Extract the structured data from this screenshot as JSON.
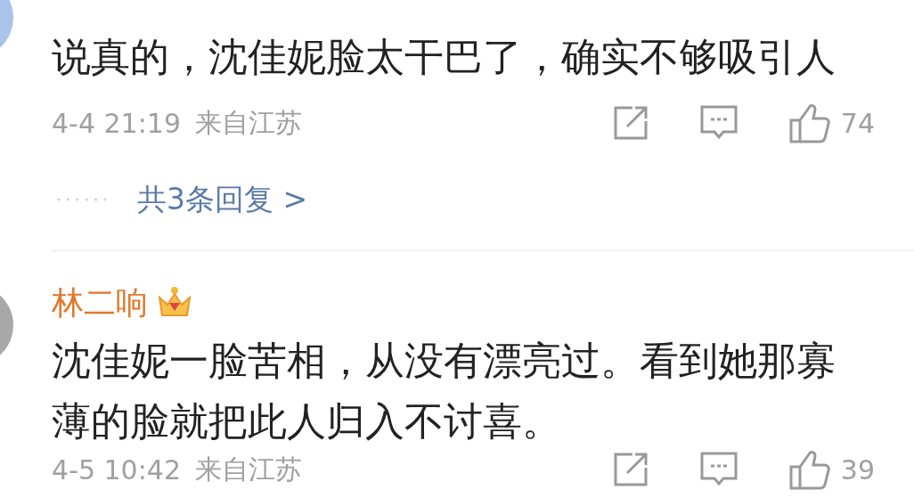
{
  "comments": [
    {
      "text": "说真的，沈佳妮脸太干巴了，确实不够吸引人",
      "time": "4-4 21:19",
      "location": "来自江苏",
      "likes": "74",
      "replies": "共3条回复 >",
      "color": "#a9c3ea"
    },
    {
      "username": "林二响",
      "crown": true,
      "text": "沈佳妮一脸苦相，从没有漂亮过。看到她那寡薄的脸就把此人归入不讨喜。",
      "time": "4-5 10:42",
      "location": "来自江苏",
      "likes": "39",
      "color": "#a8a8a8"
    }
  ]
}
